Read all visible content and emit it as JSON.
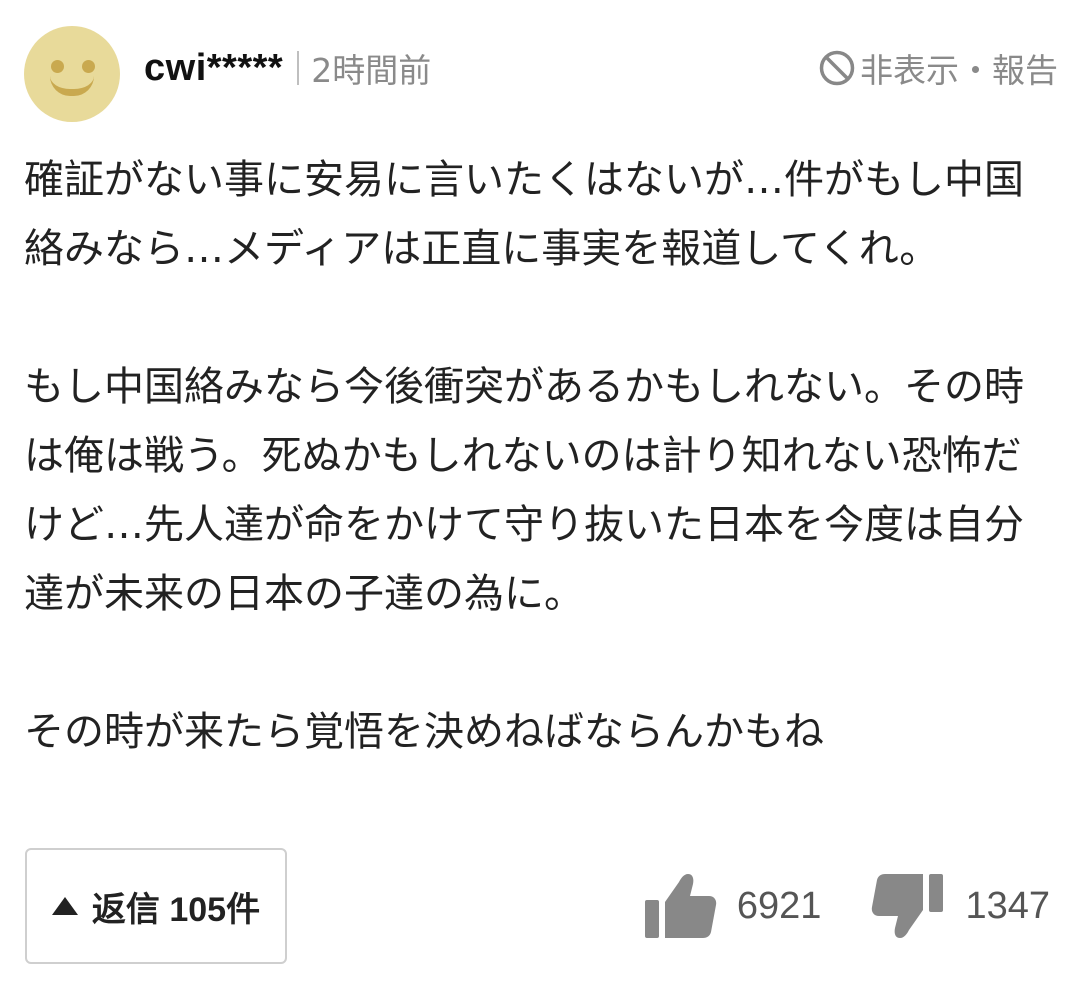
{
  "comment": {
    "username": "cwi*****",
    "timestamp": "2時間前",
    "hide_report_label": "非表示・報告",
    "paragraphs": [
      "確証がない事に安易に言いたくはないが…件がもし中国絡みなら…メディアは正直に事実を報道してくれ。",
      "もし中国絡みなら今後衝突があるかもしれない。その時は俺は戦う。死ぬかもしれないのは計り知れない恐怖だけど…先人達が命をかけて守り抜いた日本を今度は自分達が未来の日本の子達の為に。",
      "その時が来たら覚悟を決めねばならんかもね"
    ],
    "reply_label": "返信 105件",
    "likes": "6921",
    "dislikes": "1347"
  },
  "colors": {
    "avatar_bg": "#e8da9a",
    "avatar_face": "#c9a94f",
    "muted_text": "#8a8a8a",
    "icon_gray": "#888888"
  },
  "icons": {
    "avatar": "smiley-face-icon",
    "hide": "ban-icon",
    "reply": "triangle-up-icon",
    "like": "thumbs-up-icon",
    "dislike": "thumbs-down-icon"
  }
}
